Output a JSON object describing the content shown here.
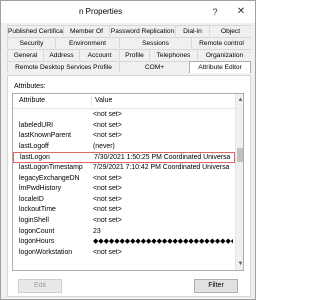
{
  "window": {
    "title": "n Properties",
    "help_glyph": "?",
    "close_glyph": "✕"
  },
  "tabs": {
    "row1": [
      "Published Certificates",
      "Member Of",
      "Password Replication",
      "Dial-in",
      "Object"
    ],
    "row2": [
      "Security",
      "Environment",
      "Sessions",
      "Remote control"
    ],
    "row3": [
      "General",
      "Address",
      "Account",
      "Profile",
      "Telephones",
      "Organization"
    ],
    "row4": [
      "Remote Desktop Services Profile",
      "COM+",
      "Attribute Editor"
    ],
    "active": "Attribute Editor"
  },
  "attributes_label": "Attributes:",
  "table": {
    "columns": [
      "Attribute",
      "Value"
    ],
    "rows": [
      {
        "attribute": "",
        "value": "<not set>"
      },
      {
        "attribute": "labeledURI",
        "value": "<not set>"
      },
      {
        "attribute": "lastKnownParent",
        "value": "<not set>"
      },
      {
        "attribute": "lastLogoff",
        "value": "(never)"
      },
      {
        "attribute": "lastLogon",
        "value": "7/30/2021 1:50:25 PM Coordinated Universa"
      },
      {
        "attribute": "lastLogonTimestamp",
        "value": "7/29/2021 7:10:42 PM Coordinated Universa"
      },
      {
        "attribute": "legacyExchangeDN",
        "value": "<not set>"
      },
      {
        "attribute": "lmPwdHistory",
        "value": "<not set>"
      },
      {
        "attribute": "localeID",
        "value": "<not set>"
      },
      {
        "attribute": "lockoutTime",
        "value": "<not set>"
      },
      {
        "attribute": "loginShell",
        "value": "<not set>"
      },
      {
        "attribute": "logonCount",
        "value": "23"
      },
      {
        "attribute": "logonHours",
        "value": "◆◆◆◆◆◆◆◆◆◆◆◆◆◆◆◆◆◆◆◆◆◆◆◆◆◆◆◆◆◆◆"
      },
      {
        "attribute": "logonWorkstation",
        "value": "<not set>"
      }
    ],
    "selected_index": 4
  },
  "buttons": {
    "edit": "Edit",
    "filter": "Filter"
  },
  "colors": {
    "selection_border": "#e06666"
  }
}
